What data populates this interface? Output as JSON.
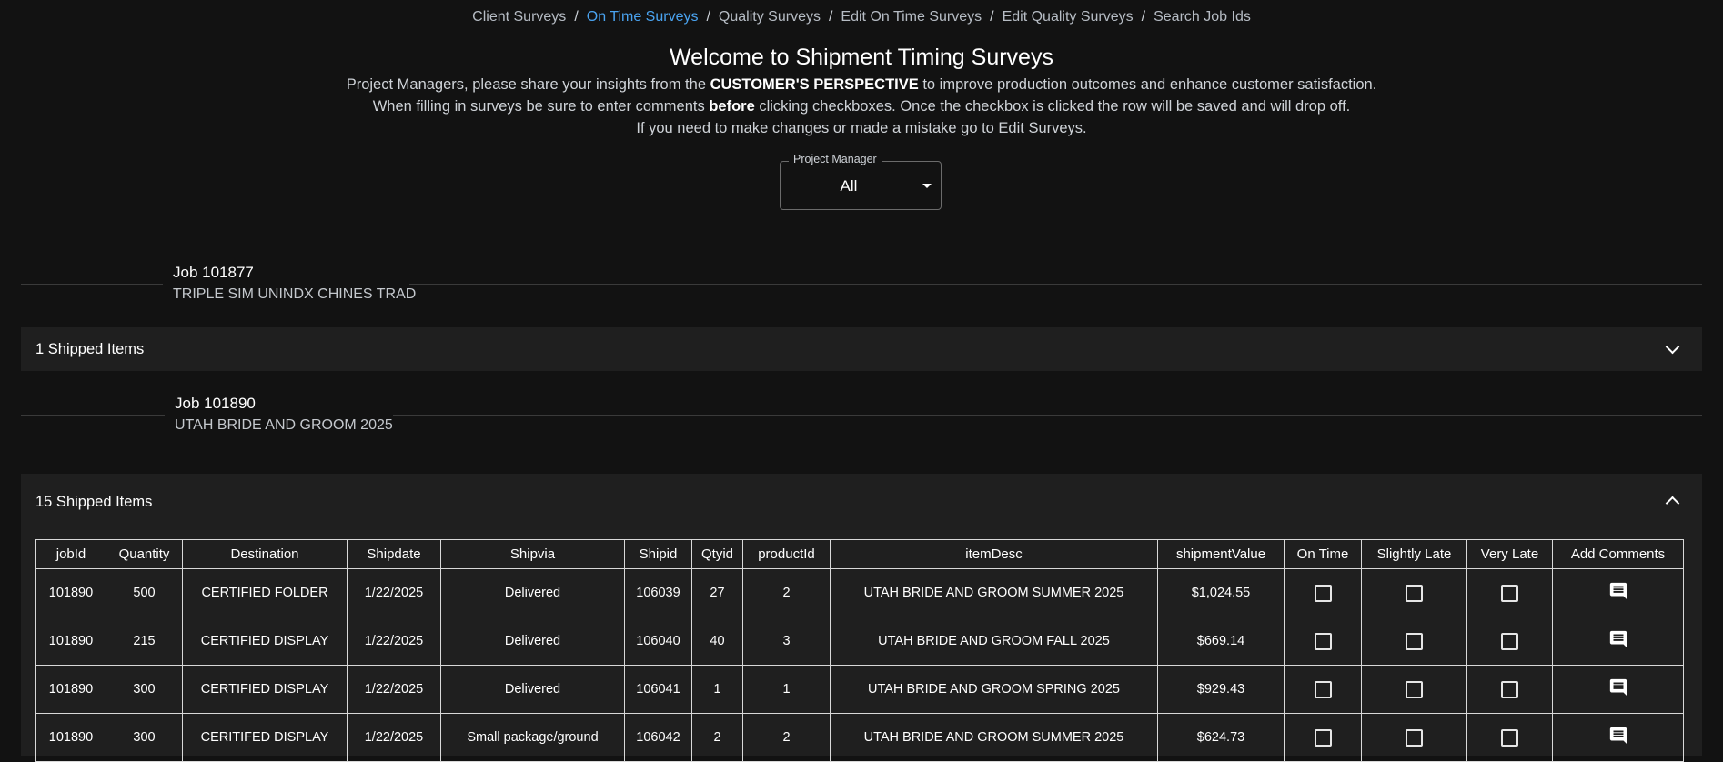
{
  "breadcrumbs": [
    {
      "label": "Client Surveys",
      "active": false
    },
    {
      "label": "On Time Surveys",
      "active": true
    },
    {
      "label": "Quality Surveys",
      "active": false
    },
    {
      "label": "Edit On Time Surveys",
      "active": false
    },
    {
      "label": "Edit Quality Surveys",
      "active": false
    },
    {
      "label": "Search Job Ids",
      "active": false
    }
  ],
  "page": {
    "title": "Welcome to Shipment Timing Surveys",
    "intro1_pre": "Project Managers, please share your insights from the ",
    "intro1_bold": "CUSTOMER'S PERSPECTIVE",
    "intro1_post": " to improve production outcomes and enhance customer satisfaction.",
    "intro2_pre": "When filling in surveys be sure to enter comments ",
    "intro2_bold": "before",
    "intro2_post": " clicking checkboxes. Once the checkbox is clicked the row will be saved and will drop off.",
    "intro3": "If you need to make changes or made a mistake go to Edit Surveys."
  },
  "pm_filter": {
    "label": "Project Manager",
    "value": "All"
  },
  "jobs": [
    {
      "title": "Job 101877",
      "desc": "TRIPLE SIM UNINDX CHINES TRAD",
      "shipped_label": "1 Shipped Items",
      "expanded": false
    },
    {
      "title": "Job 101890",
      "desc": "UTAH BRIDE AND GROOM 2025",
      "shipped_label": "15 Shipped Items",
      "expanded": true
    }
  ],
  "table": {
    "headers": [
      "jobId",
      "Quantity",
      "Destination",
      "Shipdate",
      "Shipvia",
      "Shipid",
      "Qtyid",
      "productId",
      "itemDesc",
      "shipmentValue",
      "On Time",
      "Slightly Late",
      "Very Late",
      "Add Comments"
    ],
    "rows": [
      [
        "101890",
        "500",
        "CERTIFIED FOLDER",
        "1/22/2025",
        "Delivered",
        "106039",
        "27",
        "2",
        "UTAH BRIDE AND GROOM SUMMER 2025",
        "$1,024.55"
      ],
      [
        "101890",
        "215",
        "CERTIFIED DISPLAY",
        "1/22/2025",
        "Delivered",
        "106040",
        "40",
        "3",
        "UTAH BRIDE AND GROOM FALL 2025",
        "$669.14"
      ],
      [
        "101890",
        "300",
        "CERTIFIED DISPLAY",
        "1/22/2025",
        "Delivered",
        "106041",
        "1",
        "1",
        "UTAH BRIDE AND GROOM SPRING 2025",
        "$929.43"
      ],
      [
        "101890",
        "300",
        "CERITIFED DISPLAY",
        "1/22/2025",
        "Small package/ground",
        "106042",
        "2",
        "2",
        "UTAH BRIDE AND GROOM SUMMER 2025",
        "$624.73"
      ]
    ]
  },
  "colors": {
    "background": "#121212",
    "panel": "#1f1f1f",
    "link_active": "#4aa3f0",
    "link": "#b6bcc4"
  },
  "icons": {
    "comment": "comment-icon",
    "expand": "chevron-down-icon",
    "collapse": "chevron-up-icon",
    "dropdown": "caret-down-icon"
  }
}
